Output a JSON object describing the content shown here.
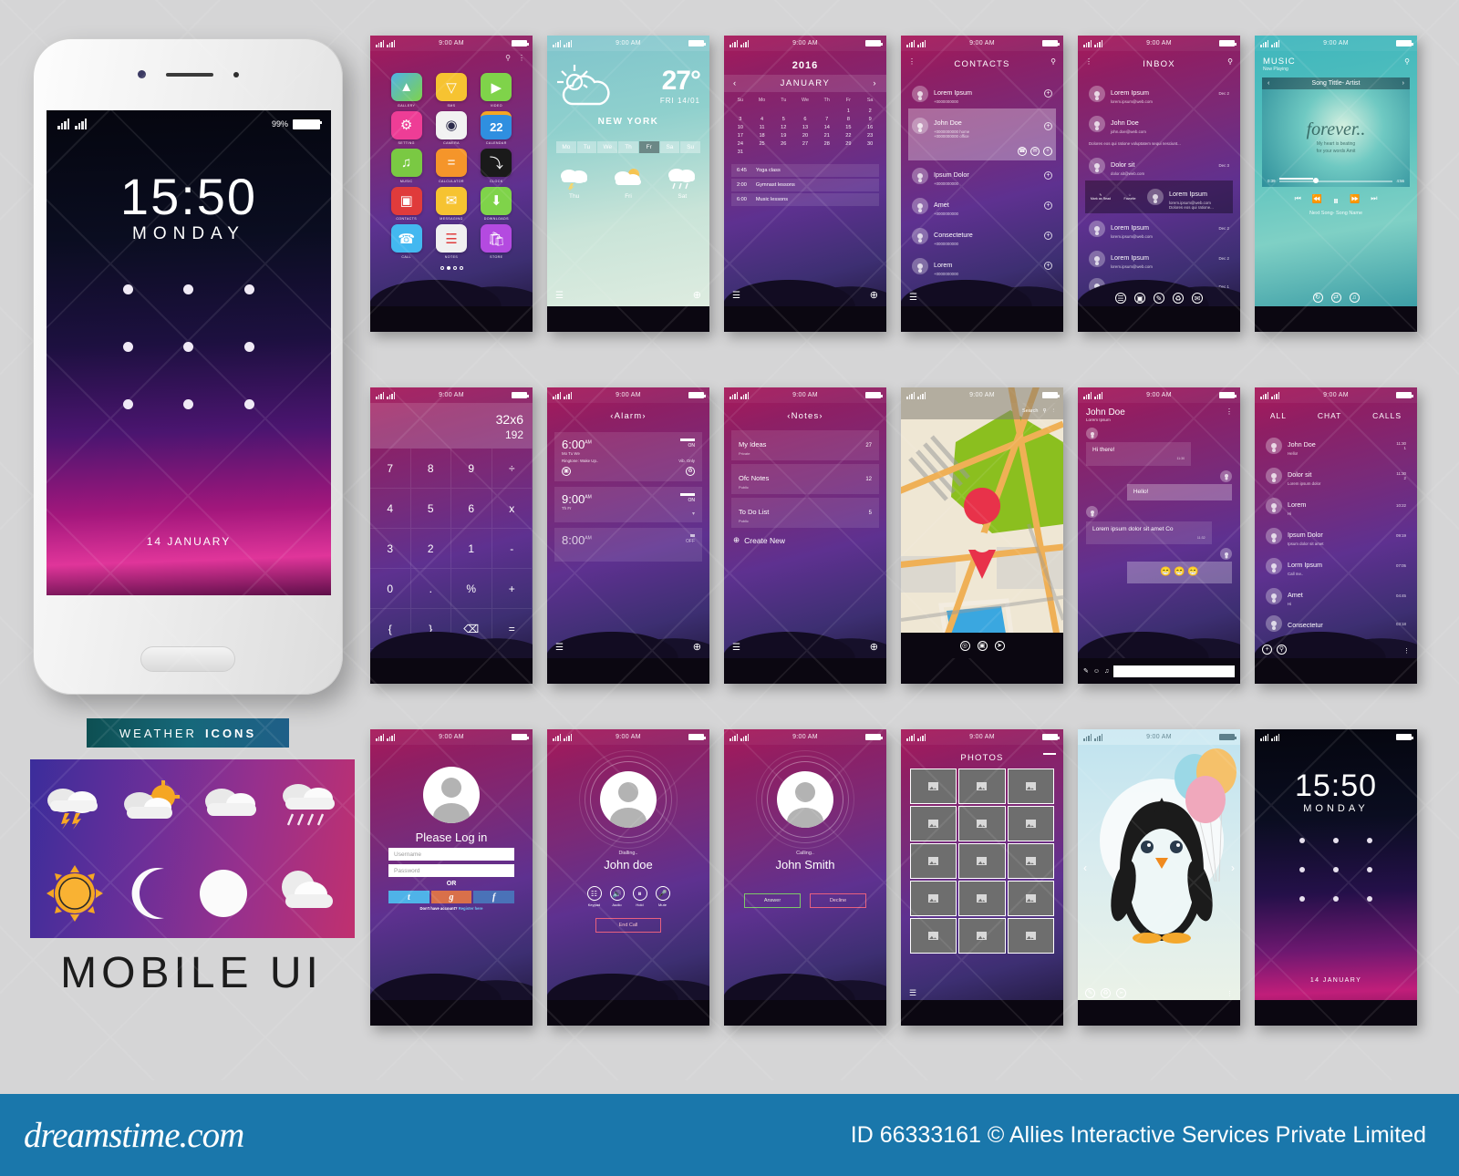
{
  "footer": {
    "logo": "dreamstime.com",
    "credit": "ID 66333161 © Allies Interactive Services Private Limited"
  },
  "common": {
    "time": "9:00 AM",
    "battery_icon": "battery-full"
  },
  "device": {
    "battery_pct": "99%",
    "time": "15:50",
    "day": "MONDAY",
    "date": "14 JANUARY"
  },
  "weather_icons_panel": {
    "badge_word1": "WEATHER",
    "badge_word2": "ICONS",
    "title": "MOBILE  UI",
    "icons": [
      "thunderstorm",
      "partly-cloudy-day",
      "cloudy",
      "rain",
      "sun",
      "crescent-moon",
      "full-moon",
      "cloudy-night"
    ]
  },
  "screens": {
    "home": {
      "apps": [
        {
          "label": "GALLERY",
          "icon": "image-icon",
          "color": "#4fb3e8"
        },
        {
          "label": "SMS",
          "icon": "envelope-icon",
          "color": "#f6c331"
        },
        {
          "label": "VIDEO",
          "icon": "play-icon",
          "color": "#7fd34a"
        },
        {
          "label": "SETTING",
          "icon": "gear-icon",
          "color": "#ee3d96"
        },
        {
          "label": "CAMERA",
          "icon": "camera-icon",
          "color": "#f2f2f2"
        },
        {
          "label": "CALENDAR",
          "icon": "calendar-icon",
          "color": "#2f8fe0"
        },
        {
          "label": "MUSIC",
          "icon": "music-note-icon",
          "color": "#7ac943"
        },
        {
          "label": "CALCULATOR",
          "icon": "equals-icon",
          "color": "#f5952a"
        },
        {
          "label": "CLOCK",
          "icon": "clock-icon",
          "color": "#1a1a1a"
        },
        {
          "label": "CONTACTS",
          "icon": "address-book-icon",
          "color": "#e03b3b"
        },
        {
          "label": "MESSAGING",
          "icon": "mail-icon",
          "color": "#f6c331"
        },
        {
          "label": "DOWNLOADS",
          "icon": "download-icon",
          "color": "#7fd34a"
        },
        {
          "label": "CALL",
          "icon": "phone-icon",
          "color": "#43b8f0"
        },
        {
          "label": "NOTES",
          "icon": "lines-icon",
          "color": "#f0f0f0"
        },
        {
          "label": "STORE",
          "icon": "bag-icon",
          "color": "#b44ae0"
        }
      ],
      "calendar_day": "22",
      "calendar_month": "SAT",
      "page_dots": 4,
      "active_dot": 1
    },
    "weather": {
      "temp": "27°",
      "date": "FRI 14/01",
      "city": "NEW YORK",
      "days": [
        "Mo",
        "Tu",
        "We",
        "Th",
        "Fr",
        "Sa",
        "Su"
      ],
      "selected_day": "Fr",
      "forecast": [
        {
          "day": "Thu",
          "icon": "thunderstorm"
        },
        {
          "day": "Fri",
          "icon": "partly-cloudy-day"
        },
        {
          "day": "Sat",
          "icon": "rain"
        }
      ]
    },
    "calendar": {
      "year": "2016",
      "month": "JANUARY",
      "weekdays": [
        "Su",
        "Mo",
        "Tu",
        "We",
        "Th",
        "Fr",
        "Sa"
      ],
      "lead_blanks": 5,
      "days_in_month": 31,
      "events": [
        {
          "time": "6:45",
          "title": "Yoga class"
        },
        {
          "time": "2:00",
          "title": "Gymnast lessons"
        },
        {
          "time": "6:00",
          "title": "Music lessons"
        }
      ]
    },
    "contacts": {
      "title": "CONTACTS",
      "items": [
        {
          "name": "Lorem Ipsum",
          "phone": "+0000000000",
          "expanded": false
        },
        {
          "name": "John Doe",
          "phone": "+0000000000 home",
          "phone2": "+0000000000 office",
          "expanded": true
        },
        {
          "name": "Ipsum Dolor",
          "phone": "+0000000000",
          "expanded": false
        },
        {
          "name": "Amet",
          "phone": "+0000000000",
          "expanded": false
        },
        {
          "name": "Consecteture",
          "phone": "+0000000000",
          "expanded": false
        },
        {
          "name": "Lorem",
          "phone": "+0000000000",
          "expanded": false
        }
      ]
    },
    "inbox": {
      "title": "INBOX",
      "items": [
        {
          "name": "Lorem Ipsum",
          "email": "lorem.ipsum@web.com",
          "preview": "",
          "date": "Dec 2"
        },
        {
          "name": "John Doe",
          "email": "john.doe@web.com",
          "preview": "Dolores eos qui ratione voluptatem sequi nesciunt...",
          "date": ""
        },
        {
          "name": "Dolor sit",
          "email": "dolor.sit@web.com",
          "preview": "",
          "date": "Dec 3"
        },
        {
          "name": "Lorem Ipsum",
          "email": "lorem.ipsum@web.com",
          "preview": "Dolores eos qui ratione...",
          "date": ""
        },
        {
          "name": "Lorem Ipsum",
          "email": "lorem.ipsum@web.com",
          "preview": "",
          "date": "Dec 2"
        },
        {
          "name": "Lorem Ipsum",
          "email": "lorem.ipsum@web.com",
          "preview": "",
          "date": "Dec 2"
        },
        {
          "name": "Amet Dolor",
          "email": "amet.dolor@web.com",
          "preview": "",
          "date": "Dec 1"
        }
      ],
      "swipe_actions": [
        "Mark as Read",
        "Favorite"
      ]
    },
    "music": {
      "title": "MUSIC",
      "subtitle": "Now Playing",
      "track": "Song Tittle- Artist",
      "art_word": "forever..",
      "art_line1": "My heart is beating",
      "art_line2": "for your words Amit",
      "elapsed": "0:39",
      "total": "4:56",
      "next": "Next Song- Song Name"
    },
    "calculator": {
      "expression": "32x6",
      "result": "192",
      "keys": [
        "7",
        "8",
        "9",
        "÷",
        "4",
        "5",
        "6",
        "x",
        "3",
        "2",
        "1",
        "-",
        "0",
        ".",
        "%",
        "+",
        "{",
        "}",
        "⌫",
        "="
      ]
    },
    "alarm": {
      "title": "Alarm",
      "items": [
        {
          "time": "6:00",
          "ampm": "AM",
          "days": "Mo Tu We",
          "ringtone": "Ringtone: Wake Up..",
          "mode": "Vib. Only",
          "state": "ON"
        },
        {
          "time": "9:00",
          "ampm": "AM",
          "days": "Th Fr",
          "ringtone": "",
          "mode": "",
          "state": "ON"
        },
        {
          "time": "8:00",
          "ampm": "AM",
          "days": "",
          "ringtone": "",
          "mode": "",
          "state": "OFF"
        }
      ]
    },
    "notes": {
      "title": "Notes",
      "items": [
        {
          "name": "My Ideas",
          "privacy": "Private",
          "count": "27"
        },
        {
          "name": "Ofc Notes",
          "privacy": "Public",
          "count": "12"
        },
        {
          "name": "To Do List",
          "privacy": "Public",
          "count": "5"
        }
      ],
      "create": "Create New"
    },
    "map": {
      "search_label": "Search",
      "pin": "location-pin"
    },
    "chat": {
      "name": "John Doe",
      "status": "Lorem Ipsum",
      "messages": [
        {
          "from": "them",
          "text": "Hi there!",
          "time": "11:30"
        },
        {
          "from": "me",
          "text": "Hello!",
          "time": "11:31"
        },
        {
          "from": "them",
          "text": "Lorem ipsum dolor sit amet Co",
          "time": "11:32"
        },
        {
          "from": "me",
          "text": "😁 😁 😁",
          "time": "11:33"
        }
      ]
    },
    "chatlist": {
      "tabs": [
        "ALL",
        "CHAT",
        "CALLS"
      ],
      "active_tab": "CHAT",
      "items": [
        {
          "name": "John Doe",
          "preview": "Hello!",
          "time": "11:30",
          "count": "1"
        },
        {
          "name": "Dolor sit",
          "preview": "Lorem ipsum dolor",
          "time": "11:30",
          "count": "2"
        },
        {
          "name": "Lorem",
          "preview": "Hi",
          "time": "10:22",
          "count": ""
        },
        {
          "name": "Ipsum Dolor",
          "preview": "Ipsum dolor sit amet",
          "time": "09:19",
          "count": ""
        },
        {
          "name": "Lorm Ipsum",
          "preview": "Call me..",
          "time": "07:05",
          "count": ""
        },
        {
          "name": "Amet",
          "preview": "Hi",
          "time": "04:45",
          "count": ""
        },
        {
          "name": "Consectetur",
          "preview": "",
          "time": "03:18",
          "count": ""
        }
      ]
    },
    "login": {
      "heading": "Please Log in",
      "username_placeholder": "Username",
      "password_placeholder": "Password",
      "or": "OR",
      "social": [
        {
          "label": "t",
          "name": "twitter",
          "color": "#4fb3e8"
        },
        {
          "label": "g",
          "name": "google",
          "color": "#d9704a"
        },
        {
          "label": "f",
          "name": "facebook",
          "color": "#4a72b8"
        }
      ],
      "register_text": "Don't have account?",
      "register_link": "Register here"
    },
    "dialling": {
      "status": "Dialling..",
      "name": "John doe",
      "actions": [
        {
          "label": "Keypad",
          "icon": "keypad-icon"
        },
        {
          "label": "Audio",
          "icon": "speaker-icon"
        },
        {
          "label": "Hold",
          "icon": "pause-icon"
        },
        {
          "label": "Mute",
          "icon": "mic-icon"
        }
      ],
      "end_label": "End Call"
    },
    "incoming": {
      "status": "Calling..",
      "name": "John Smith",
      "answer": "Answer",
      "decline": "Decline"
    },
    "photos": {
      "title": "PHOTOS",
      "cells": 15
    },
    "penguin": {
      "alt": "penguin-with-balloons"
    },
    "lock": {
      "time": "15:50",
      "day": "MONDAY",
      "date": "14 JANUARY"
    }
  }
}
